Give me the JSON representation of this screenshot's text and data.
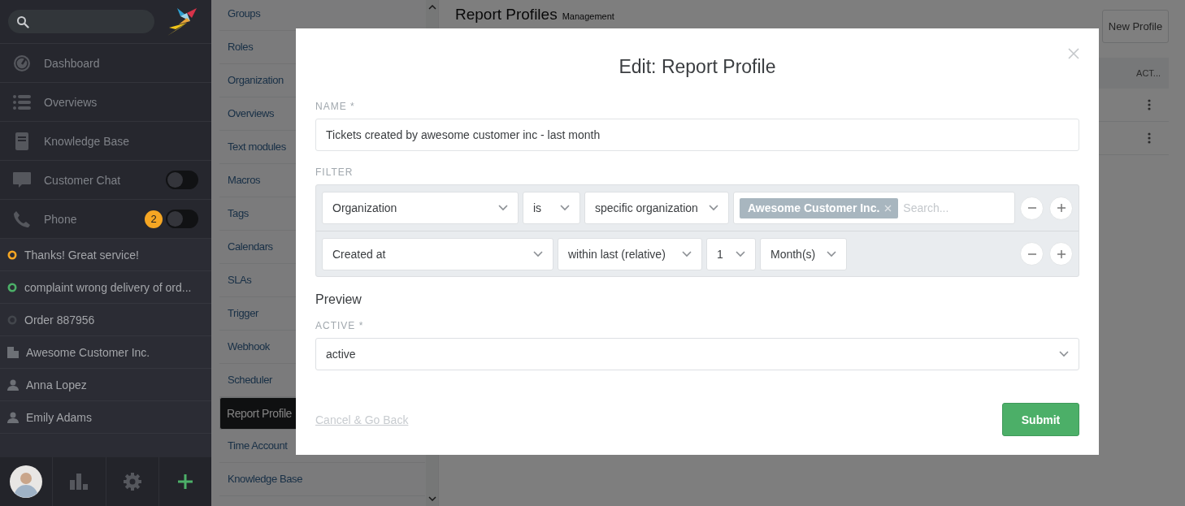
{
  "sidebar": {
    "nav": [
      {
        "kind": "dashboard",
        "label": "Dashboard"
      },
      {
        "kind": "overviews",
        "label": "Overviews"
      },
      {
        "kind": "knowledge",
        "label": "Knowledge Base"
      },
      {
        "kind": "chat",
        "label": "Customer Chat",
        "toggle_on": false
      },
      {
        "kind": "phone",
        "label": "Phone",
        "badge": "2",
        "toggle_on": false
      }
    ],
    "recent": [
      {
        "kind": "ticket",
        "label": "Thanks! Great service!",
        "color": "#f5a623"
      },
      {
        "kind": "ticket",
        "label": "complaint wrong delivery of ord...",
        "color": "#4caf68"
      },
      {
        "kind": "ticket",
        "label": "Order 887956",
        "color": "#43464c"
      },
      {
        "kind": "organization",
        "label": "Awesome Customer Inc."
      },
      {
        "kind": "user",
        "label": "Anna Lopez"
      },
      {
        "kind": "user",
        "label": "Emily Adams"
      }
    ]
  },
  "admin_nav": [
    {
      "label": "Groups",
      "selected": false
    },
    {
      "label": "Roles",
      "selected": false
    },
    {
      "label": "Organization",
      "selected": false
    },
    {
      "label": "Overviews",
      "selected": false
    },
    {
      "label": "Text modules",
      "selected": false
    },
    {
      "label": "Macros",
      "selected": false
    },
    {
      "label": "Tags",
      "selected": false
    },
    {
      "label": "Calendars",
      "selected": false
    },
    {
      "label": "SLAs",
      "selected": false
    },
    {
      "label": "Trigger",
      "selected": false
    },
    {
      "label": "Webhook",
      "selected": false
    },
    {
      "label": "Scheduler",
      "selected": false
    },
    {
      "label": "Report Profile",
      "selected": true
    },
    {
      "label": "Time Account",
      "selected": false
    },
    {
      "label": "Knowledge Base",
      "selected": false
    }
  ],
  "page": {
    "title": "Report Profiles",
    "subtitle": "Management",
    "new_button": "New Profile",
    "table": {
      "columns": [
        "ACT..."
      ]
    }
  },
  "modal": {
    "title": "Edit: Report Profile",
    "name_label": "NAME *",
    "name_value": "Tickets created by awesome customer inc - last month",
    "filter_label": "FILTER",
    "filters": [
      {
        "fields": [
          {
            "kind": "select",
            "value": "Organization"
          },
          {
            "kind": "select",
            "value": "is"
          },
          {
            "kind": "select",
            "value": "specific organization"
          },
          {
            "kind": "tokens",
            "tokens": [
              "Awesome Customer Inc."
            ],
            "placeholder": "Search..."
          }
        ]
      },
      {
        "fields": [
          {
            "kind": "select",
            "value": "Created at"
          },
          {
            "kind": "select",
            "value": "within last (relative)"
          },
          {
            "kind": "select",
            "value": "1"
          },
          {
            "kind": "select",
            "value": "Month(s)"
          }
        ]
      }
    ],
    "preview_label": "Preview",
    "active_label": "ACTIVE *",
    "active_value": "active",
    "cancel": "Cancel & Go Back",
    "submit": "Submit"
  }
}
